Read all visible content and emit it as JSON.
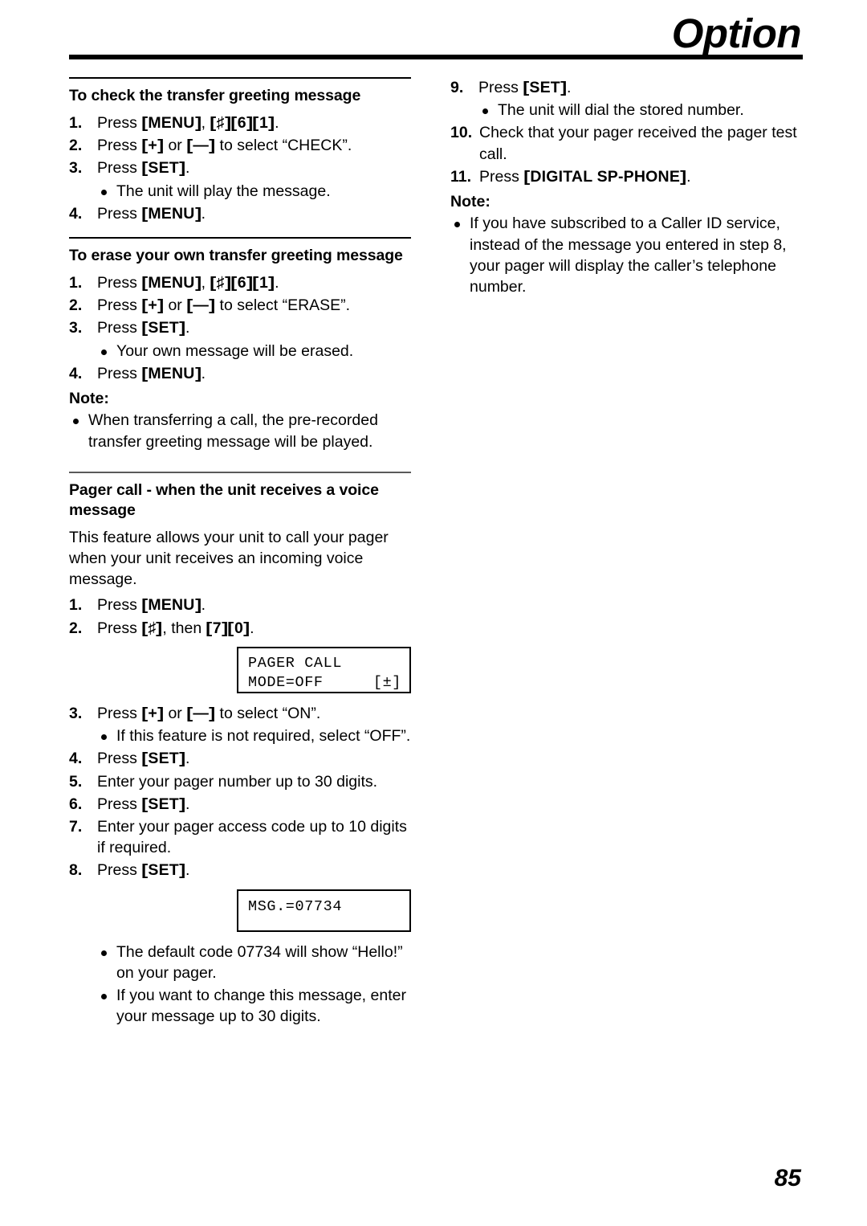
{
  "header": {
    "title": "Option"
  },
  "page_number": "85",
  "left_column": {
    "section1": {
      "heading": "To check the transfer greeting message",
      "steps": [
        {
          "num": "1.",
          "pre": "Press ",
          "keys": "[MENU], [#][6][1]",
          "post": "."
        },
        {
          "num": "2.",
          "pre": "Press ",
          "keys": "[+] or [-]",
          "post": " to select “CHECK”."
        },
        {
          "num": "3.",
          "pre": "Press ",
          "keys": "[SET]",
          "post": "."
        },
        {
          "num": "4.",
          "pre": "Press ",
          "keys": "[MENU]",
          "post": "."
        }
      ],
      "bullet_after_step3": "The unit will play the message."
    },
    "section2": {
      "heading": "To erase your own transfer greeting message",
      "steps": [
        {
          "num": "1.",
          "pre": "Press ",
          "keys": "[MENU], [#][6][1]",
          "post": "."
        },
        {
          "num": "2.",
          "pre": "Press ",
          "keys": "[+] or [-]",
          "post": " to select “ERASE”."
        },
        {
          "num": "3.",
          "pre": "Press ",
          "keys": "[SET]",
          "post": "."
        },
        {
          "num": "4.",
          "pre": "Press ",
          "keys": "[MENU]",
          "post": "."
        }
      ],
      "bullet_after_step3": "Your own message will be erased.",
      "note_label": "Note:",
      "note_bullet": "When transferring a call, the pre-recorded transfer greeting message will be played."
    },
    "section3": {
      "heading": "Pager call - when the unit receives a voice message",
      "intro": "This feature allows your unit to call your pager when your unit receives an incoming voice message.",
      "step1_pre": "Press ",
      "step1_num": "1.",
      "step2_num": "2.",
      "step2_pre": "Press ",
      "step2_mid": ", then ",
      "step2_post": ".",
      "lcd1_line1": "PAGER CALL",
      "lcd1_line2_left": "MODE=OFF",
      "lcd1_line2_right": "[±]",
      "step3_num": "3.",
      "step3_pre": "Press ",
      "step3_post": " to select “ON”.",
      "step3_bullet": "If this feature is not required, select “OFF”.",
      "step4_num": "4.",
      "step4_pre": "Press ",
      "step4_post": ".",
      "step5_num": "5.",
      "step5_text": "Enter your pager number up to 30 digits.",
      "step6_num": "6.",
      "step6_pre": "Press ",
      "step6_post": ".",
      "step7_num": "7.",
      "step7_text": "Enter your pager access code up to 10 digits if required.",
      "step8_num": "8.",
      "step8_pre": "Press ",
      "step8_post": ".",
      "lcd2_line1": "MSG.=07734",
      "bullet1": "The default code 07734 will show “Hello!” on your pager.",
      "bullet2": "If you want to change this message, enter your message up to 30 digits."
    }
  },
  "right_column": {
    "step9_num": "9.",
    "step9_pre": "Press ",
    "step9_post": ".",
    "step9_bullet": "The unit will dial the stored number.",
    "step10_num": "10.",
    "step10_text": "Check that your pager received the pager test call.",
    "step11_num": "11.",
    "step11_pre": "Press ",
    "step11_post": ".",
    "note_label": "Note:",
    "note_bullet": "If you have subscribed to a Caller ID service, instead of the message you entered in step 8, your pager will display the caller’s telephone number."
  },
  "keys": {
    "menu": "MENU",
    "set": "SET",
    "hash": "♯",
    "plus": "+",
    "minus": "—",
    "six": "6",
    "one": "1",
    "seven": "7",
    "zero": "0",
    "digital_sp_phone": "DIGITAL SP-PHONE"
  }
}
